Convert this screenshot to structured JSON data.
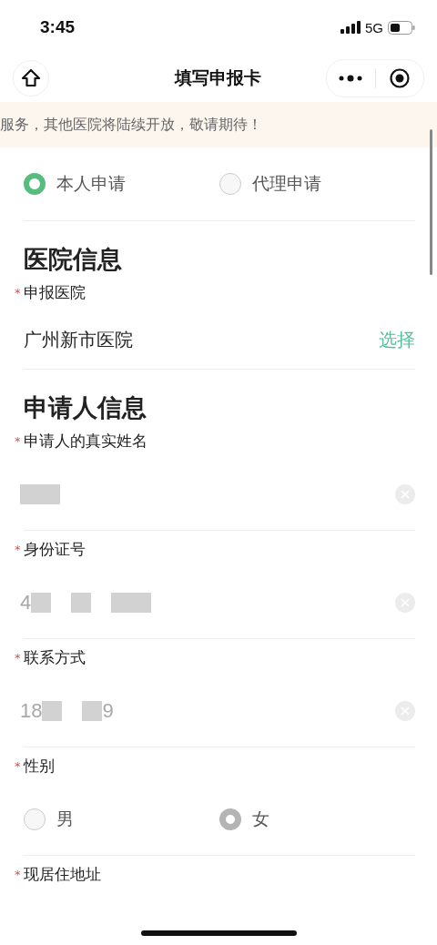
{
  "status_bar": {
    "time": "3:45",
    "network": "5G"
  },
  "nav": {
    "title": "填写申报卡"
  },
  "notice": {
    "text": "服务，其他医院将陆续开放，敬请期待！"
  },
  "applicant_type": [
    {
      "label": "本人申请",
      "selected": true
    },
    {
      "label": "代理申请",
      "selected": false
    }
  ],
  "sections": [
    {
      "heading": "医院信息",
      "fields": [
        {
          "kind": "select",
          "label": "申报医院",
          "required_mark": "*",
          "value": "广州新市医院",
          "action": "选择"
        }
      ]
    },
    {
      "heading": "申请人信息",
      "fields": [
        {
          "kind": "input",
          "label": "申请人的真实姓名",
          "required_mark": "*",
          "value_parts": [
            {
              "kind": "blur"
            },
            {
              "kind": "blur"
            }
          ]
        },
        {
          "kind": "input",
          "label": "身份证号",
          "required_mark": "*",
          "value_parts": [
            {
              "kind": "text",
              "text": "4"
            },
            {
              "kind": "blur"
            },
            {
              "kind": "gap"
            },
            {
              "kind": "blur"
            },
            {
              "kind": "gap"
            },
            {
              "kind": "blur"
            },
            {
              "kind": "blur"
            }
          ]
        },
        {
          "kind": "input",
          "label": "联系方式",
          "required_mark": "*",
          "value_parts": [
            {
              "kind": "text",
              "text": "18"
            },
            {
              "kind": "blur"
            },
            {
              "kind": "gap"
            },
            {
              "kind": "blur"
            },
            {
              "kind": "text",
              "text": "9"
            }
          ]
        },
        {
          "kind": "radio",
          "label": "性别",
          "required_mark": "*",
          "disabled": true,
          "options": [
            {
              "label": "男",
              "selected": false
            },
            {
              "label": "女",
              "selected": true
            }
          ]
        },
        {
          "kind": "heading_only",
          "label": "现居住地址",
          "required_mark": "*"
        }
      ]
    }
  ]
}
